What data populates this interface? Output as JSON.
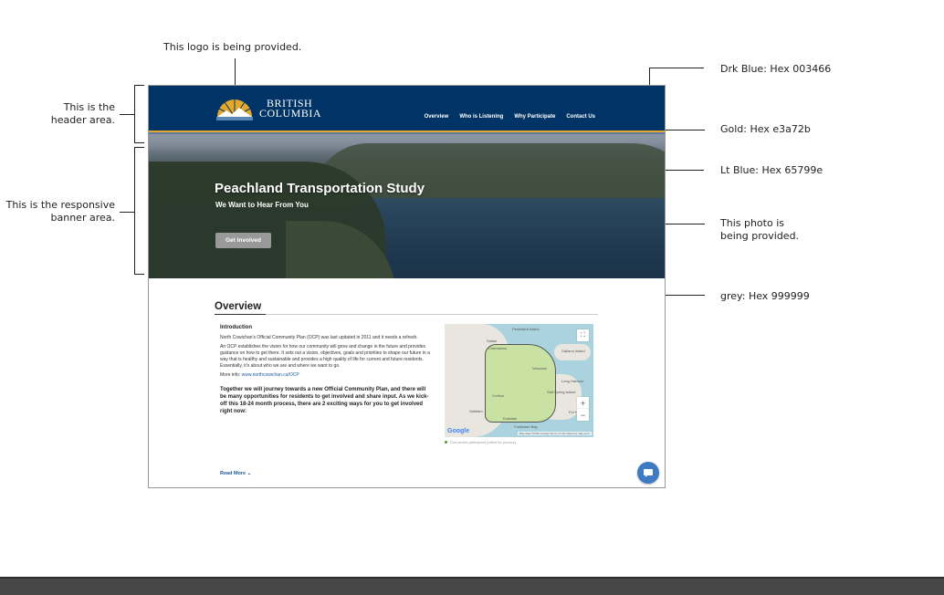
{
  "annotations": {
    "logo_note": "This logo is being provided.",
    "header_note_line1": "This is the",
    "header_note_line2": "header area.",
    "banner_note_line1": "This is the responsive",
    "banner_note_line2": "banner area.",
    "drk_blue": "Drk Blue: Hex 003466",
    "gold": "Gold: Hex e3a72b",
    "lt_blue": "Lt Blue: Hex 65799e",
    "photo_line1": "This photo is",
    "photo_line2": "being provided.",
    "grey": "grey: Hex 999999"
  },
  "colors": {
    "drk_blue": "#003466",
    "gold": "#e3a72b",
    "lt_blue": "#65799e",
    "grey": "#999999"
  },
  "logo": {
    "line1": "BRITISH",
    "line2": "COLUMBIA"
  },
  "nav": {
    "items": [
      "Overview",
      "Who is Listening",
      "Why Participate",
      "Contact Us"
    ]
  },
  "banner": {
    "title": "Peachland Transportation Study",
    "subtitle": "We Want to Hear From You",
    "button_label": "Get Involved"
  },
  "overview": {
    "heading": "Overview",
    "intro_heading": "Introduction",
    "para1": "North Cowichan's Official Community Plan (OCP) was last updated in 2011 and it needs a refresh.",
    "para2": "An OCP establishes the vision for how our community will grow and change in the future and provides guidance on how to get there. It sets out a vision, objectives, goals and priorities to shape our future in a way that is healthy and sustainable and provides a high quality of life for current and future residents. Essentially, it's about who we are and where we want to go.",
    "more_info_label": "More info: ",
    "more_info_link": "www.northcowichan.ca/OCP",
    "bold_para": "Together we will journey towards a new Official Community Plan, and there will be many opportunities for residents to get involved and share input. As we kick-off this 18-24 month process, there are 2 exciting ways for you to get involved right now:",
    "read_more": "Read More"
  },
  "map": {
    "labels": [
      "Penelakut Island",
      "Saltair",
      "Chemainus",
      "Galiano Island",
      "Vesuvius",
      "Long Harbour",
      "Salt Spring Island",
      "Crofton",
      "Ful Har",
      "Cowichan Bay",
      "Koksilah",
      "Sahtlam"
    ],
    "google": "Google",
    "attribution": "Map data ©2019 Google   Terms of Use   Report a map error",
    "legend": "Connected participant (offset for privacy)",
    "zoom_in": "+",
    "zoom_out": "−"
  }
}
